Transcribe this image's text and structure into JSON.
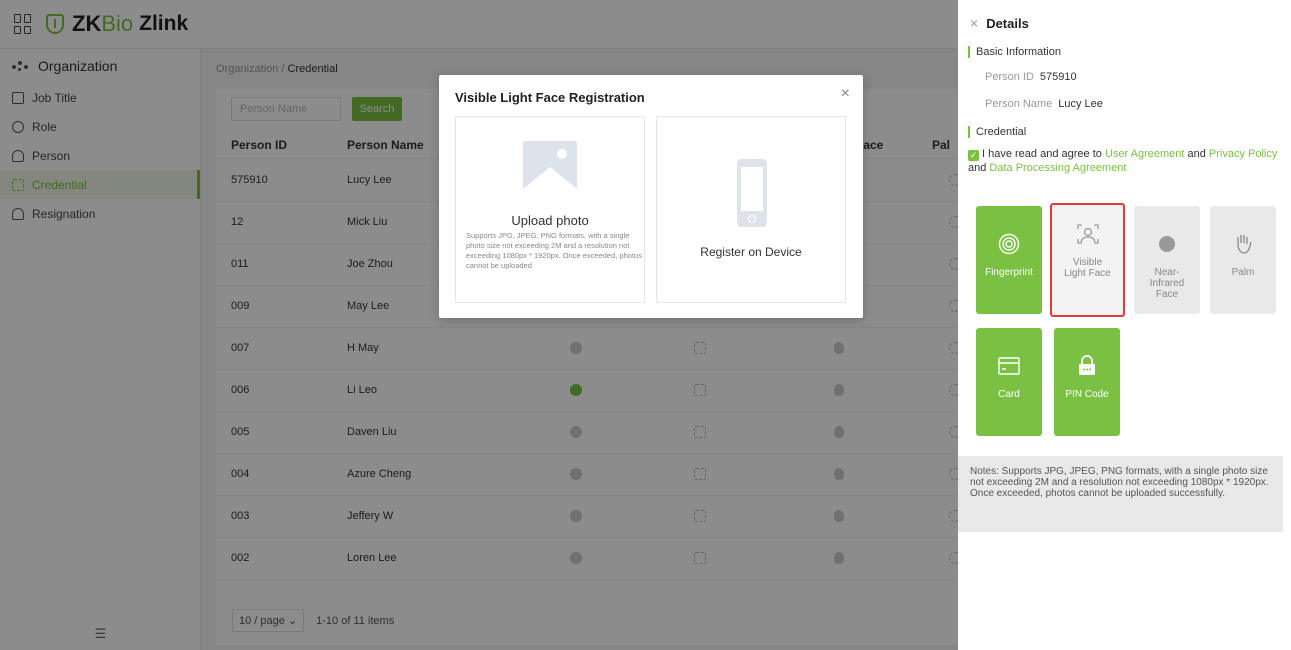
{
  "brand": {
    "zk": "ZK",
    "bio": "Bio",
    "zlink": "Zlink"
  },
  "sidebar": {
    "header": "Organization",
    "items": [
      {
        "label": "Job Title",
        "active": false
      },
      {
        "label": "Role",
        "active": false
      },
      {
        "label": "Person",
        "active": false
      },
      {
        "label": "Credential",
        "active": true
      },
      {
        "label": "Resignation",
        "active": false
      }
    ],
    "footer_icon": "☰"
  },
  "breadcrumb": {
    "parent": "Organization",
    "sep": " / ",
    "current": "Credential"
  },
  "search": {
    "placeholder": "Person Name",
    "button": "Search"
  },
  "table": {
    "headers": [
      "Person ID",
      "Person Name",
      "Face",
      "Pal"
    ],
    "rows": [
      {
        "id": "575910",
        "name": "Lucy Lee"
      },
      {
        "id": "12",
        "name": "Mick Liu"
      },
      {
        "id": "011",
        "name": "Joe Zhou"
      },
      {
        "id": "009",
        "name": "May Lee"
      },
      {
        "id": "007",
        "name": "H May"
      },
      {
        "id": "006",
        "name": "Li Leo"
      },
      {
        "id": "005",
        "name": "Daven Liu"
      },
      {
        "id": "004",
        "name": "Azure Cheng"
      },
      {
        "id": "003",
        "name": "Jeffery W"
      },
      {
        "id": "002",
        "name": "Loren Lee"
      }
    ]
  },
  "pager": {
    "size": "10 / page",
    "caret": "⌄",
    "summary": "1-10 of 11 items"
  },
  "modal": {
    "title": "Visible Light Face Registration",
    "close": "×",
    "upload_title": "Upload photo",
    "upload_desc": "Supports JPG, JPEG, PNG formats, with a single photo size not exceeding 2M and a resolution not exceeding 1080px * 1920px. Once exceeded, photos cannot be uploaded",
    "device_title": "Register on Device"
  },
  "details": {
    "close": "×",
    "title": "Details",
    "basic_section": "Basic Information",
    "person_id_label": "Person ID",
    "person_id": "575910",
    "person_name_label": "Person Name",
    "person_name": "Lucy Lee",
    "credential_section": "Credential",
    "agree_prefix": "I have read and agree to ",
    "user_agreement": "User Agreement",
    "and1": " and ",
    "privacy_policy": "Privacy Policy",
    "and2": " and ",
    "data_processing": "Data Processing Agreement",
    "tiles": {
      "fingerprint": "Fingerprint",
      "visible_face": "Visible Light Face",
      "nir_face": "Near-Infrared Face",
      "palm": "Palm",
      "card": "Card",
      "pin": "PIN Code"
    },
    "notes": "Notes: Supports JPG, JPEG, PNG formats, with a single photo size not exceeding 2M and a resolution not exceeding 1080px * 1920px. Once exceeded, photos cannot be uploaded successfully."
  },
  "colors": {
    "accent": "#7ac143",
    "highlight": "#e53935"
  }
}
